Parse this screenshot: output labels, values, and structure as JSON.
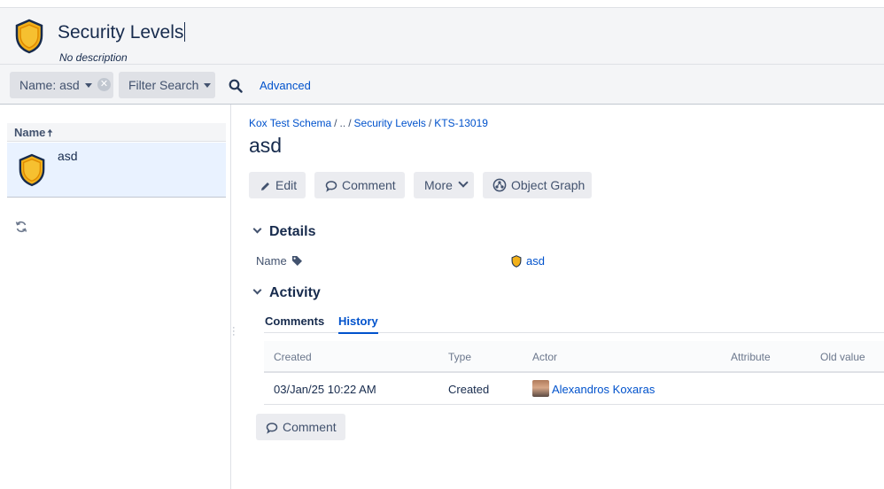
{
  "header": {
    "title": "Security Levels",
    "description": "No description"
  },
  "filters": {
    "name_chip": "Name: asd",
    "filter_search": "Filter Search",
    "advanced": "Advanced"
  },
  "list": {
    "column_header": "Name",
    "sort_indicator": "🠅",
    "items": [
      {
        "label": "asd",
        "icon": "shield-icon"
      }
    ]
  },
  "breadcrumb": {
    "schema": "Kox Test Schema",
    "ellipsis": "..",
    "type": "Security Levels",
    "key": "KTS-13019"
  },
  "object": {
    "title": "asd"
  },
  "toolbar": {
    "edit": "Edit",
    "comment": "Comment",
    "more": "More",
    "object_graph": "Object Graph"
  },
  "details": {
    "heading": "Details",
    "attributes": [
      {
        "name": "Name",
        "value": "asd"
      }
    ]
  },
  "activity": {
    "heading": "Activity",
    "tabs": [
      "Comments",
      "History"
    ],
    "active_tab": "History",
    "columns": [
      "Created",
      "Type",
      "Actor",
      "Attribute",
      "Old value"
    ],
    "rows": [
      {
        "created": "03/Jan/25 10:22 AM",
        "type": "Created",
        "actor": "Alexandros Koxaras"
      }
    ],
    "comment_button": "Comment"
  },
  "colors": {
    "link": "#0052cc",
    "shield_gold": "#f2b11a",
    "shield_outline": "#172b4d",
    "selected_row": "#e9f2ff"
  }
}
